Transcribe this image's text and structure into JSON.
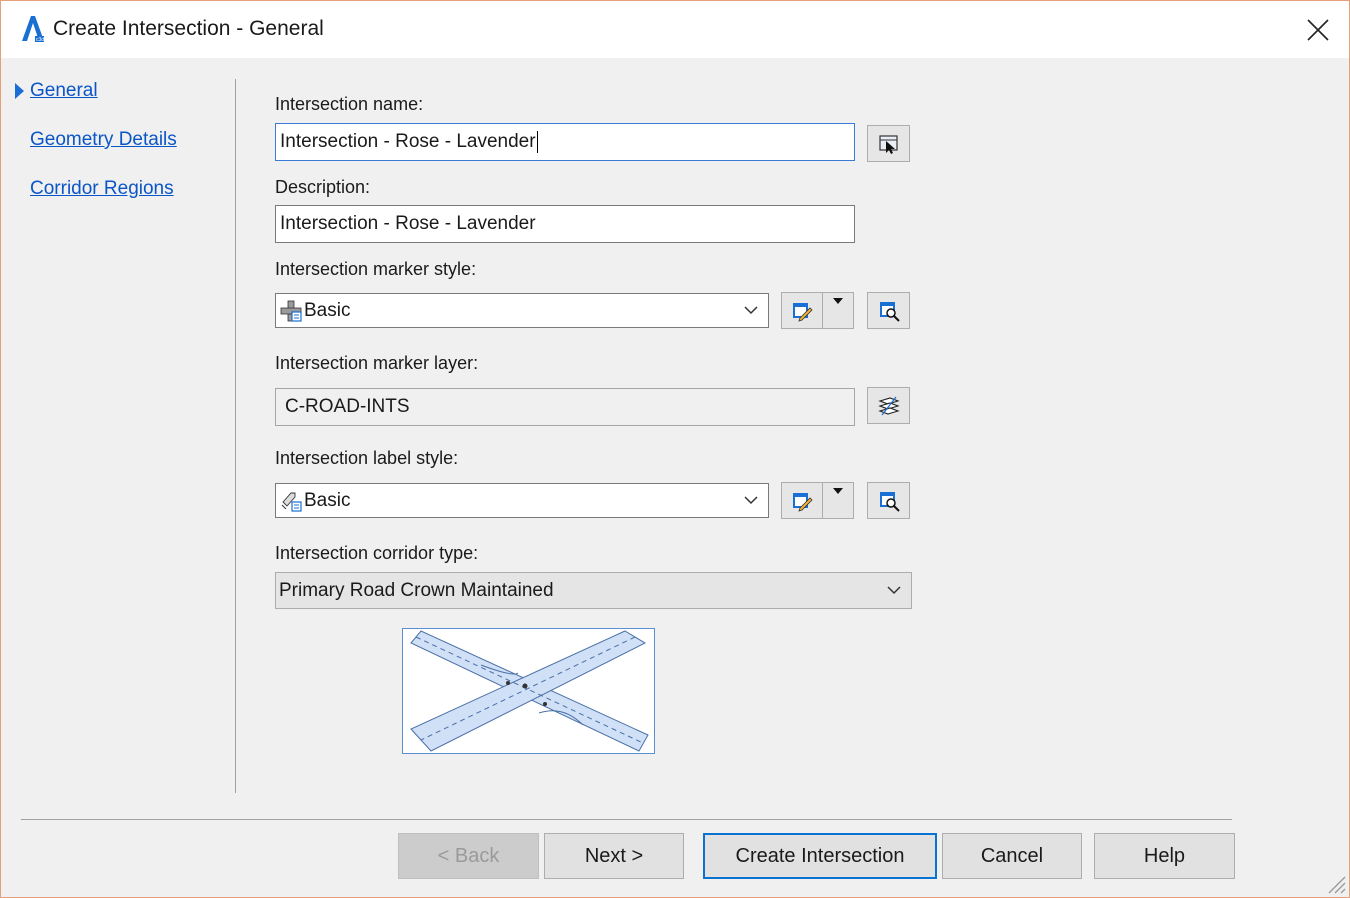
{
  "window": {
    "title": "Create Intersection - General",
    "accent_color": "#0b56c7",
    "app_icon": "autocad-civil-icon"
  },
  "nav": {
    "items": [
      {
        "label": "General",
        "active": true
      },
      {
        "label": "Geometry Details",
        "active": false
      },
      {
        "label": "Corridor Regions",
        "active": false
      }
    ]
  },
  "form": {
    "name_label": "Intersection name:",
    "name_value": "Intersection - Rose - Lavender",
    "description_label": "Description:",
    "description_value": "Intersection - Rose - Lavender",
    "marker_style_label": "Intersection marker style:",
    "marker_style_value": "Basic",
    "marker_layer_label": "Intersection marker layer:",
    "marker_layer_value": "C-ROAD-INTS",
    "label_style_label": "Intersection label style:",
    "label_style_value": "Basic",
    "corridor_type_label": "Intersection corridor type:",
    "corridor_type_value": "Primary Road Crown Maintained"
  },
  "icons": {
    "pick": "pick-from-drawing-icon",
    "edit_style": "edit-style-icon",
    "preview": "style-preview-icon",
    "layer": "layer-stack-icon"
  },
  "buttons": {
    "back": "< Back",
    "next": "Next >",
    "create": "Create Intersection",
    "cancel": "Cancel",
    "help": "Help"
  }
}
